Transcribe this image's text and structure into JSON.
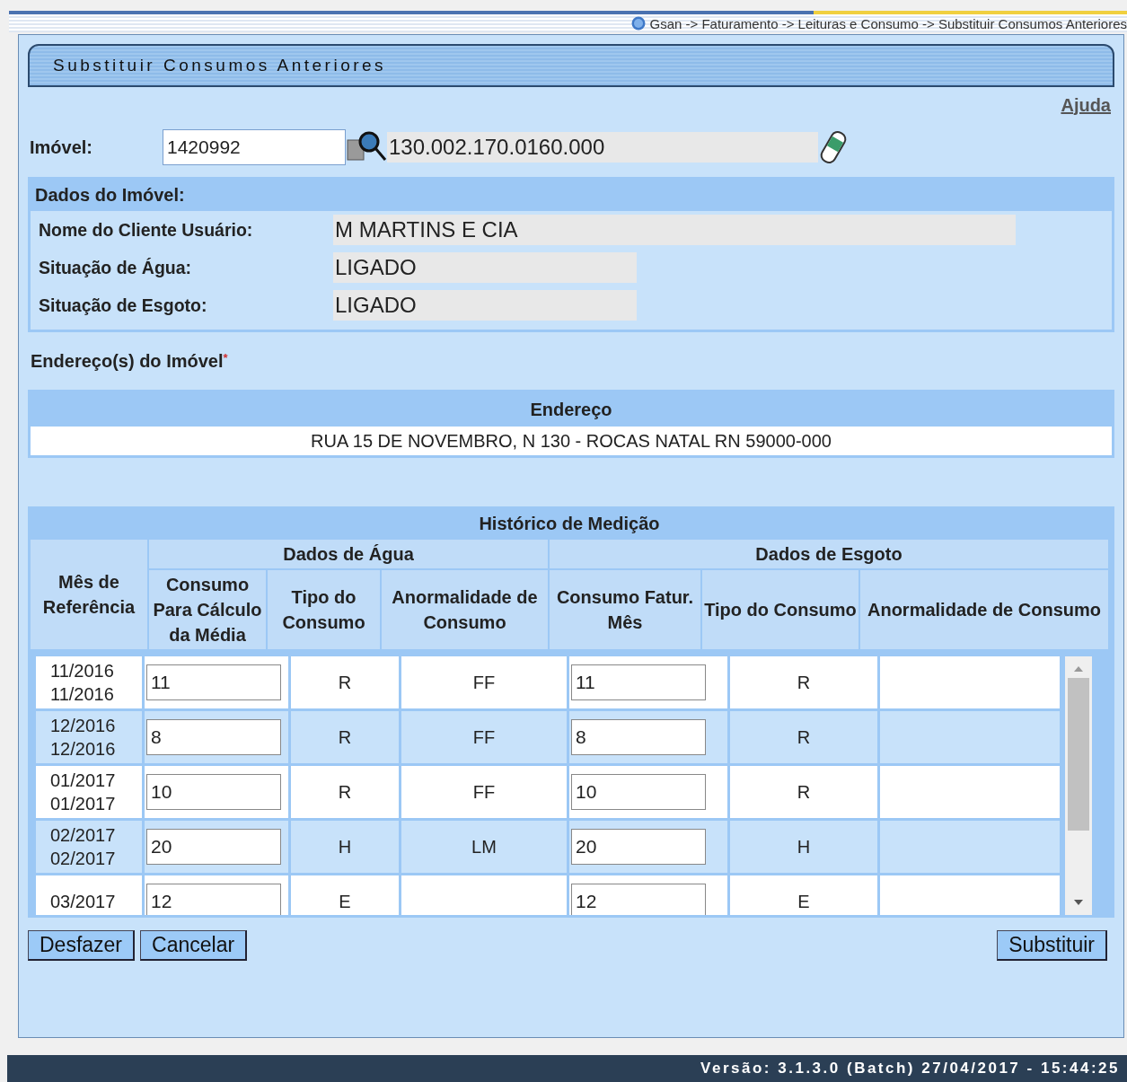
{
  "breadcrumb": "Gsan -> Faturamento -> Leituras e Consumo -> Substituir Consumos Anteriores",
  "page_title": "Substituir Consumos Anteriores",
  "help_link": "Ajuda",
  "imovel": {
    "label": "Imóvel:",
    "value": "1420992",
    "inscricao": "130.002.170.0160.000"
  },
  "dados_imovel": {
    "title": "Dados do Imóvel:",
    "fields": [
      {
        "label": "Nome do Cliente Usuário:",
        "value": "M MARTINS E CIA",
        "wide": true
      },
      {
        "label": "Situação de Água:",
        "value": "LIGADO",
        "wide": false
      },
      {
        "label": "Situação de Esgoto:",
        "value": "LIGADO",
        "wide": false
      }
    ]
  },
  "enderecos": {
    "label": "Endereço(s) do Imóvel",
    "required_mark": "*",
    "column": "Endereço",
    "rows": [
      "RUA 15 DE NOVEMBRO, N 130 - ROCAS NATAL RN 59000-000"
    ]
  },
  "historico": {
    "title": "Histórico de Medição",
    "month_header": "Mês de Referência",
    "groups": [
      {
        "label": "Dados de Água",
        "columns": [
          "Consumo Para Cálculo da Média",
          "Tipo do Consumo",
          "Anormalidade de Consumo"
        ]
      },
      {
        "label": "Dados de Esgoto",
        "columns": [
          "Consumo Fatur. Mês",
          "Tipo do Consumo",
          "Anormalidade de Consumo"
        ]
      }
    ],
    "rows": [
      {
        "month_lines": [
          "11/2016",
          "11/2016"
        ],
        "agua_consumo": "11",
        "agua_tipo": "R",
        "agua_anormalidade": "FF",
        "esgoto_consumo": "11",
        "esgoto_tipo": "R"
      },
      {
        "month_lines": [
          "12/2016",
          "12/2016"
        ],
        "agua_consumo": "8",
        "agua_tipo": "R",
        "agua_anormalidade": "FF",
        "esgoto_consumo": "8",
        "esgoto_tipo": "R"
      },
      {
        "month_lines": [
          "01/2017",
          "01/2017"
        ],
        "agua_consumo": "10",
        "agua_tipo": "R",
        "agua_anormalidade": "FF",
        "esgoto_consumo": "10",
        "esgoto_tipo": "R"
      },
      {
        "month_lines": [
          "02/2017",
          "02/2017"
        ],
        "agua_consumo": "20",
        "agua_tipo": "H",
        "agua_anormalidade": "LM",
        "esgoto_consumo": "20",
        "esgoto_tipo": "H"
      },
      {
        "month_lines": [
          "03/2017"
        ],
        "agua_consumo": "12",
        "agua_tipo": "E",
        "agua_anormalidade": "",
        "esgoto_consumo": "12",
        "esgoto_tipo": "E"
      }
    ]
  },
  "buttons_left": [
    "Desfazer",
    "Cancelar"
  ],
  "button_right": "Substituir",
  "footer": "Versão: 3.1.3.0 (Batch) 27/04/2017 - 15:44:25"
}
